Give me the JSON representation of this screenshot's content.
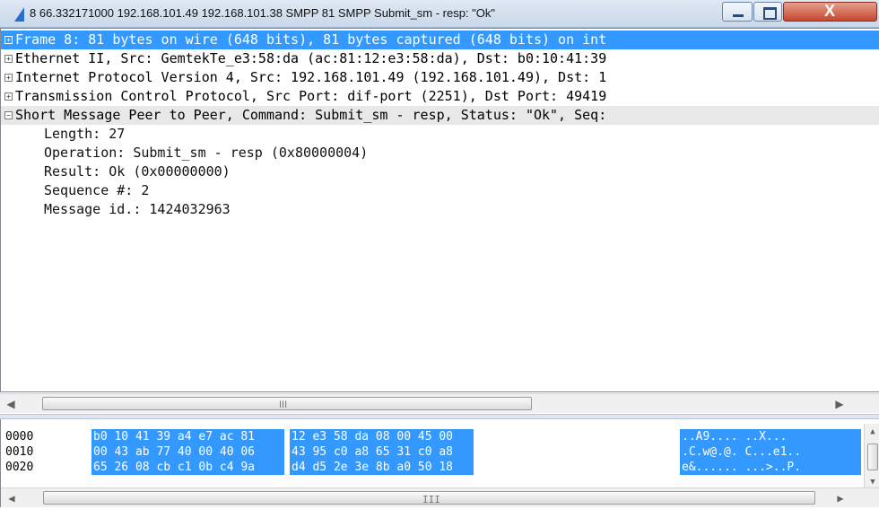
{
  "window": {
    "title": "8 66.332171000 192.168.101.49 192.168.101.38 SMPP 81 SMPP Submit_sm - resp: \"Ok\"",
    "minimize_icon": "minimize-icon",
    "maximize_icon": "maximize-icon",
    "close_label": "X"
  },
  "tree": {
    "rows": [
      {
        "expander": "+",
        "text": "Frame 8: 81 bytes on wire (648 bits), 81 bytes captured (648 bits) on int"
      },
      {
        "expander": "+",
        "text": "Ethernet II, Src: GemtekTe_e3:58:da (ac:81:12:e3:58:da), Dst: b0:10:41:39"
      },
      {
        "expander": "+",
        "text": "Internet Protocol Version 4, Src: 192.168.101.49 (192.168.101.49), Dst: 1"
      },
      {
        "expander": "+",
        "text": "Transmission Control Protocol, Src Port: dif-port (2251), Dst Port: 49419"
      },
      {
        "expander": "−",
        "text": "Short Message Peer to Peer, Command: Submit_sm - resp, Status: \"Ok\", Seq:"
      }
    ],
    "children": [
      "Length: 27",
      "Operation: Submit_sm - resp (0x80000004)",
      "Result: Ok (0x00000000)",
      "Sequence #: 2",
      "Message id.: 1424032963"
    ],
    "scroll_grip": "III"
  },
  "hex": {
    "rows": [
      {
        "offset": "0000",
        "b1": "b0 10 41 39 a4 e7 ac 81",
        "b2": "12 e3 58 da 08 00 45 00",
        "ascii": "..A9.... ..X..."
      },
      {
        "offset": "0010",
        "b1": "00 43 ab 77 40 00 40 06",
        "b2": "43 95 c0 a8 65 31 c0 a8",
        "ascii": ".C.w@.@. C...e1.."
      },
      {
        "offset": "0020",
        "b1": "65 26 08 cb c1 0b c4 9a",
        "b2": "d4 d5 2e 3e 8b a0 50 18",
        "ascii": "e&...... ...>..P."
      }
    ],
    "scroll_grip": "III"
  },
  "colors": {
    "selection": "#3399ff",
    "highlight_row": "#e8e8e8",
    "titlebar": "#c9d8ea",
    "close_button": "#c5472e"
  }
}
